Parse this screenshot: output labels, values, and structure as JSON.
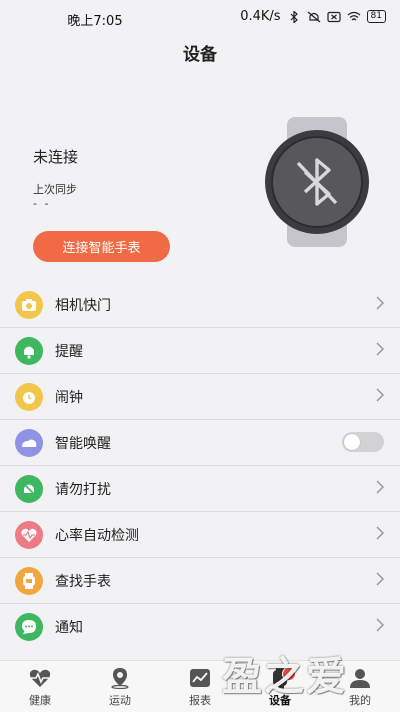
{
  "status_bar": {
    "time": "晚上7:05",
    "speed": "0.4K/s",
    "battery": "81"
  },
  "header": {
    "title": "设备"
  },
  "device": {
    "status": "未连接",
    "last_sync_label": "上次同步",
    "last_sync_value": "- -",
    "connect_button": "连接智能手表"
  },
  "menu": {
    "items": [
      {
        "label": "相机快门",
        "icon": "camera-icon",
        "color": "#f1c64a"
      },
      {
        "label": "提醒",
        "icon": "bell-icon",
        "color": "#3fb660"
      },
      {
        "label": "闹钟",
        "icon": "alarm-clock-icon",
        "color": "#f1c64a"
      },
      {
        "label": "智能唤醒",
        "icon": "sleep-icon",
        "color": "#8e93e6",
        "toggle": false
      },
      {
        "label": "请勿打扰",
        "icon": "mute-icon",
        "color": "#3fb660"
      },
      {
        "label": "心率自动检测",
        "icon": "heart-rate-icon",
        "color": "#ee7a86"
      },
      {
        "label": "查找手表",
        "icon": "find-watch-icon",
        "color": "#f1a73e"
      },
      {
        "label": "通知",
        "icon": "chat-icon",
        "color": "#3fb660"
      }
    ]
  },
  "tabs": [
    {
      "label": "健康",
      "icon": "heart-pulse-icon"
    },
    {
      "label": "运动",
      "icon": "location-pin-icon"
    },
    {
      "label": "报表",
      "icon": "chart-icon"
    },
    {
      "label": "设备",
      "icon": "watch-icon",
      "active": true
    },
    {
      "label": "我的",
      "icon": "profile-icon"
    }
  ],
  "watermark": "盈之爱"
}
